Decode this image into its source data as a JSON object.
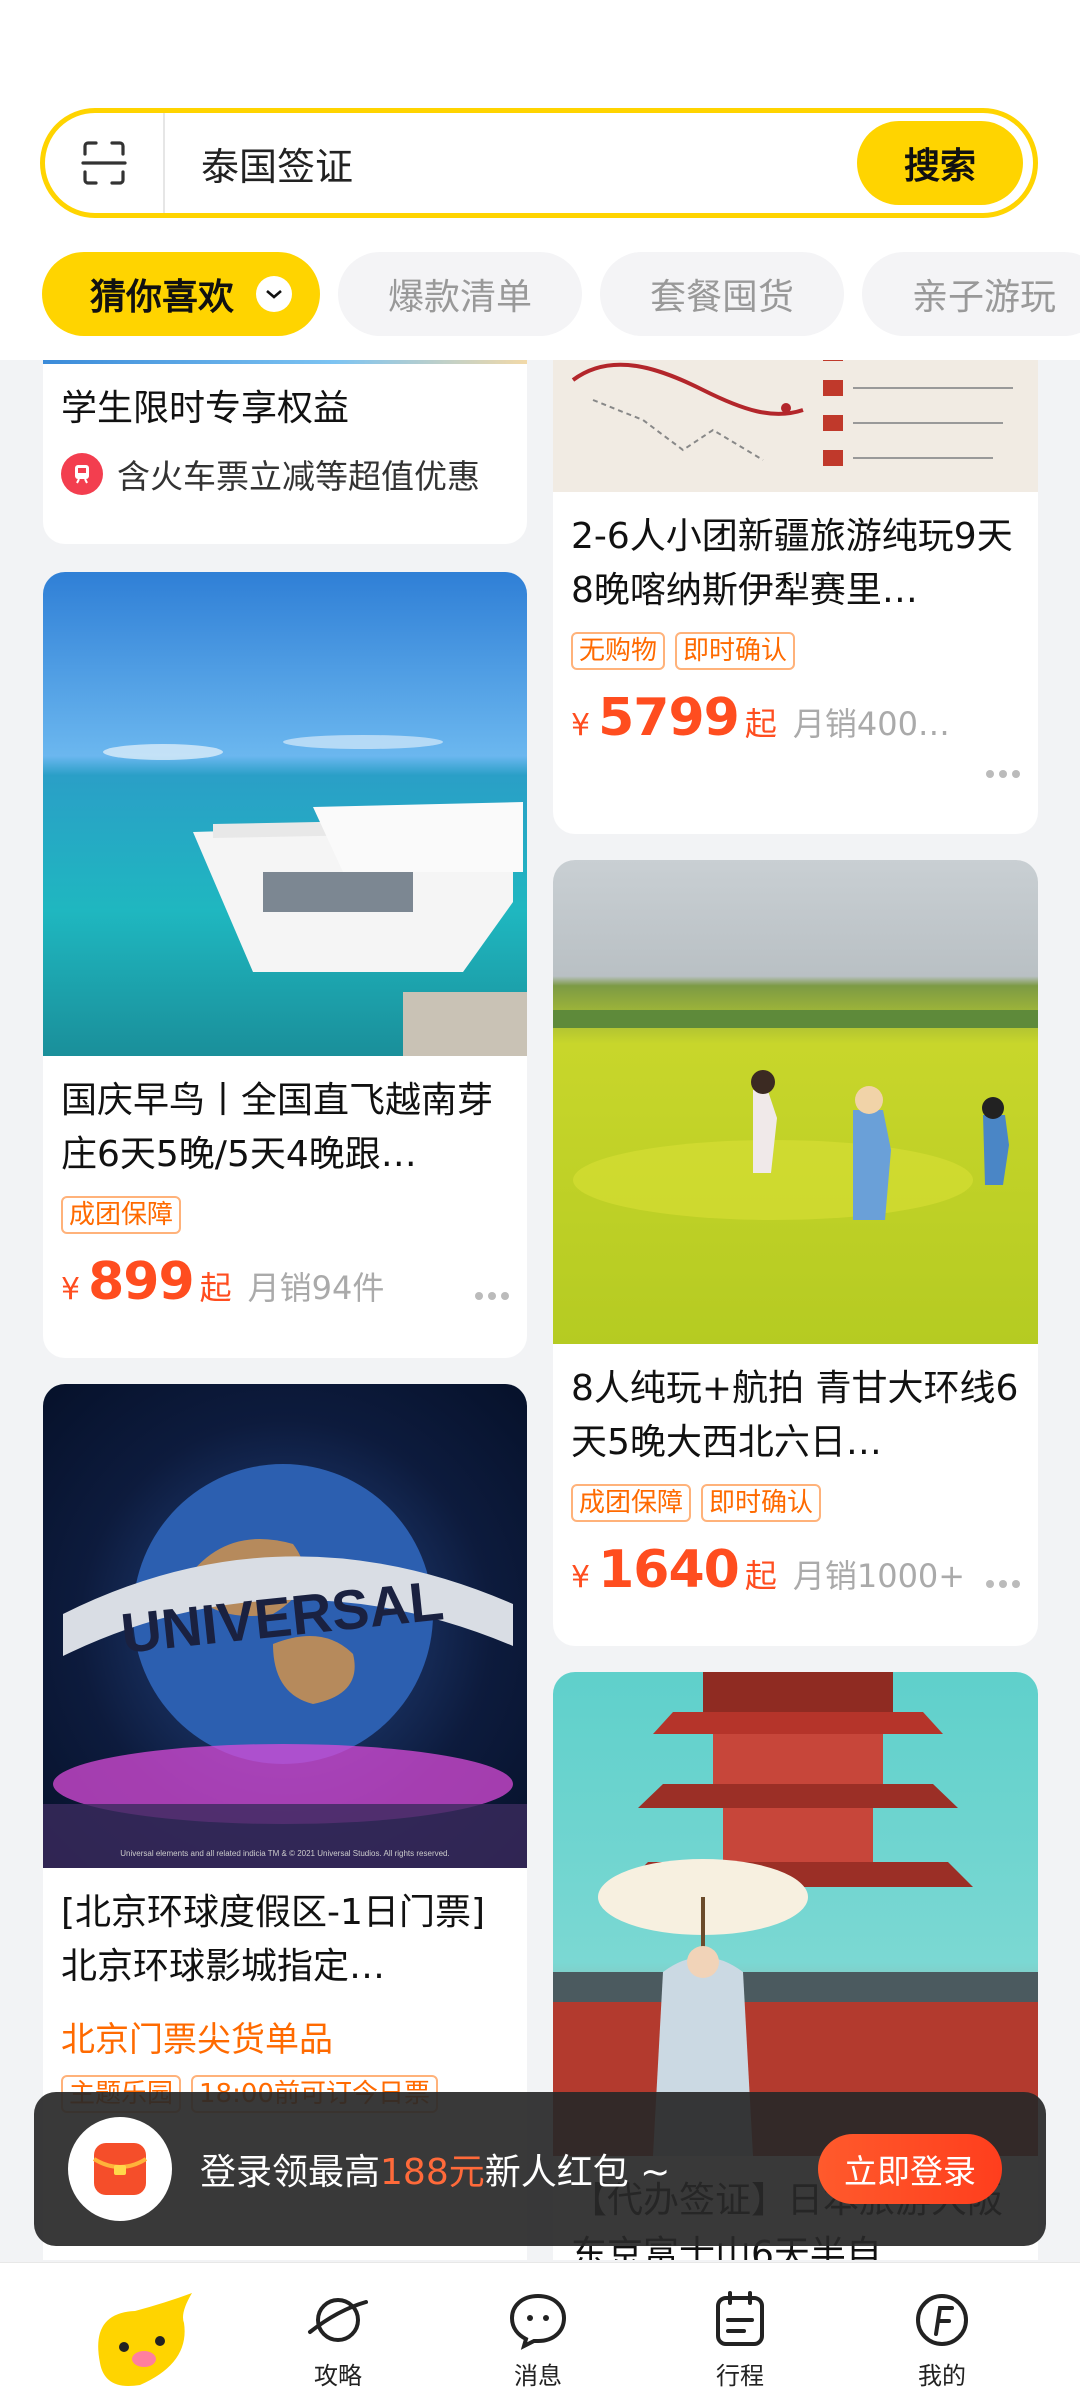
{
  "search": {
    "query": "泰国签证",
    "button": "搜索"
  },
  "tabs": [
    {
      "label": "猜你喜欢",
      "active": true
    },
    {
      "label": "爆款清单"
    },
    {
      "label": "套餐囤货"
    },
    {
      "label": "亲子游玩"
    }
  ],
  "cards": {
    "student": {
      "title": "学生限时专享权益",
      "subtitle": "含火车票立减等超值优惠"
    },
    "xinjiang": {
      "title": "2-6人小团新疆旅游纯玩9天8晚喀纳斯伊犁赛里…",
      "tags": [
        "无购物",
        "即时确认"
      ],
      "currency": "¥",
      "price": "5799",
      "suffix": "起",
      "sales": "月销400…"
    },
    "vietnam": {
      "title": "国庆早鸟丨全国直飞越南芽庄6天5晚/5天4晚跟…",
      "tags": [
        "成团保障"
      ],
      "currency": "¥",
      "price": "899",
      "suffix": "起",
      "sales": "月销94件"
    },
    "qinggan": {
      "title": "8人纯玩+航拍 青甘大环线6天5晚大西北六日…",
      "tags": [
        "成团保障",
        "即时确认"
      ],
      "currency": "¥",
      "price": "1640",
      "suffix": "起",
      "sales": "月销1000+"
    },
    "universal": {
      "title": "[北京环球度假区-1日门票]北京环球影城指定…",
      "highlight": "北京门票尖货单品",
      "tags": [
        "主题乐园",
        "18:00前可订今日票"
      ],
      "image_text": "UNIVERSAL",
      "image_caption": "Universal elements and all related indicia TM & © 2021 Universal Studios. All rights reserved."
    },
    "japan": {
      "title": "【代办签证】日本旅游大阪东京富士山6天半自…"
    }
  },
  "toast": {
    "pre": "登录领最高",
    "amount": "188元",
    "post": "新人红包 ~",
    "button": "立即登录"
  },
  "nav": [
    {
      "label": "攻略",
      "icon": "planet-icon"
    },
    {
      "label": "消息",
      "icon": "chat-icon"
    },
    {
      "label": "行程",
      "icon": "itinerary-icon"
    },
    {
      "label": "我的",
      "icon": "profile-icon"
    }
  ],
  "colors": {
    "brand": "#ffd400",
    "price": "#ff4d1f",
    "tag": "#ff6a00"
  }
}
